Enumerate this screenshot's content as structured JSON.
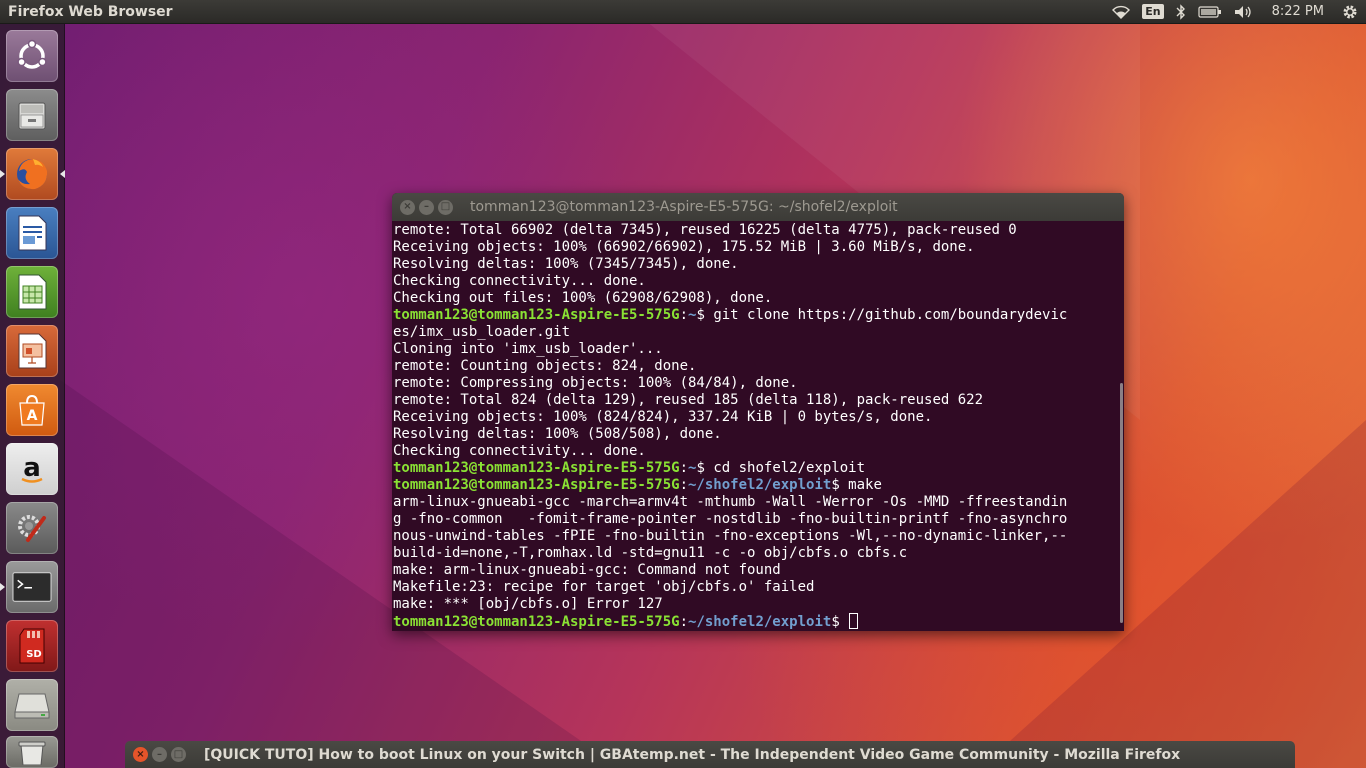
{
  "top_panel": {
    "app_title": "Firefox Web Browser",
    "keyboard_layout": "En",
    "clock": "8:22 PM",
    "indicators": [
      "wifi-icon",
      "keyboard-layout",
      "bluetooth-icon",
      "battery-icon",
      "volume-icon",
      "clock",
      "gear-icon"
    ]
  },
  "launcher": {
    "items": [
      {
        "name": "ubuntu-dash",
        "icon": "ubuntu-logo-icon"
      },
      {
        "name": "files",
        "icon": "file-cabinet-icon"
      },
      {
        "name": "firefox",
        "icon": "firefox-icon",
        "active": true
      },
      {
        "name": "libreoffice-writer",
        "icon": "writer-doc-icon"
      },
      {
        "name": "libreoffice-calc",
        "icon": "calc-spreadsheet-icon"
      },
      {
        "name": "libreoffice-impress",
        "icon": "impress-presentation-icon"
      },
      {
        "name": "ubuntu-software",
        "icon": "software-bag-icon"
      },
      {
        "name": "amazon",
        "icon": "amazon-icon"
      },
      {
        "name": "system-settings",
        "icon": "settings-wrench-icon"
      },
      {
        "name": "terminal",
        "icon": "terminal-icon",
        "running": true
      },
      {
        "name": "sd-card-tool",
        "icon": "sd-card-icon"
      },
      {
        "name": "drive",
        "icon": "drive-icon"
      },
      {
        "name": "trash",
        "icon": "trash-icon"
      }
    ]
  },
  "terminal": {
    "title": "tomman123@tomman123-Aspire-E5-575G: ~/shofel2/exploit",
    "lines": [
      {
        "text": "remote: Total 66902 (delta 7345), reused 16225 (delta 4775), pack-reused 0"
      },
      {
        "text": "Receiving objects: 100% (66902/66902), 175.52 MiB | 3.60 MiB/s, done."
      },
      {
        "text": "Resolving deltas: 100% (7345/7345), done."
      },
      {
        "text": "Checking connectivity... done."
      },
      {
        "text": "Checking out files: 100% (62908/62908), done."
      },
      {
        "user": "tomman123@tomman123-Aspire-E5-575G",
        "path": "~",
        "cmd": "git clone https://github.com/boundarydevic"
      },
      {
        "text": "es/imx_usb_loader.git"
      },
      {
        "text": "Cloning into 'imx_usb_loader'..."
      },
      {
        "text": "remote: Counting objects: 824, done."
      },
      {
        "text": "remote: Compressing objects: 100% (84/84), done."
      },
      {
        "text": "remote: Total 824 (delta 129), reused 185 (delta 118), pack-reused 622"
      },
      {
        "text": "Receiving objects: 100% (824/824), 337.24 KiB | 0 bytes/s, done."
      },
      {
        "text": "Resolving deltas: 100% (508/508), done."
      },
      {
        "text": "Checking connectivity... done."
      },
      {
        "user": "tomman123@tomman123-Aspire-E5-575G",
        "path": "~",
        "cmd": "cd shofel2/exploit"
      },
      {
        "user": "tomman123@tomman123-Aspire-E5-575G",
        "path": "~/shofel2/exploit",
        "cmd": "make"
      },
      {
        "text": "arm-linux-gnueabi-gcc -march=armv4t -mthumb -Wall -Werror -Os -MMD -ffreestandin"
      },
      {
        "text": "g -fno-common   -fomit-frame-pointer -nostdlib -fno-builtin-printf -fno-asynchro"
      },
      {
        "text": "nous-unwind-tables -fPIE -fno-builtin -fno-exceptions -Wl,--no-dynamic-linker,--"
      },
      {
        "text": "build-id=none,-T,romhax.ld -std=gnu11 -c -o obj/cbfs.o cbfs.c"
      },
      {
        "text": "make: arm-linux-gnueabi-gcc: Command not found"
      },
      {
        "text": "Makefile:23: recipe for target 'obj/cbfs.o' failed"
      },
      {
        "text": "make: *** [obj/cbfs.o] Error 127"
      },
      {
        "user": "tomman123@tomman123-Aspire-E5-575G",
        "path": "~/shofel2/exploit",
        "cmd": "",
        "cursor": true
      }
    ]
  },
  "minimized_window": {
    "title": "[QUICK TUTO] How to boot Linux on your Switch | GBAtemp.net - The Independent Video Game Community - Mozilla Firefox"
  },
  "colors": {
    "terminal_bg": "#300a24",
    "prompt_user": "#8ae234",
    "prompt_path": "#729fcf",
    "panel_bg": "#2b2a27"
  }
}
